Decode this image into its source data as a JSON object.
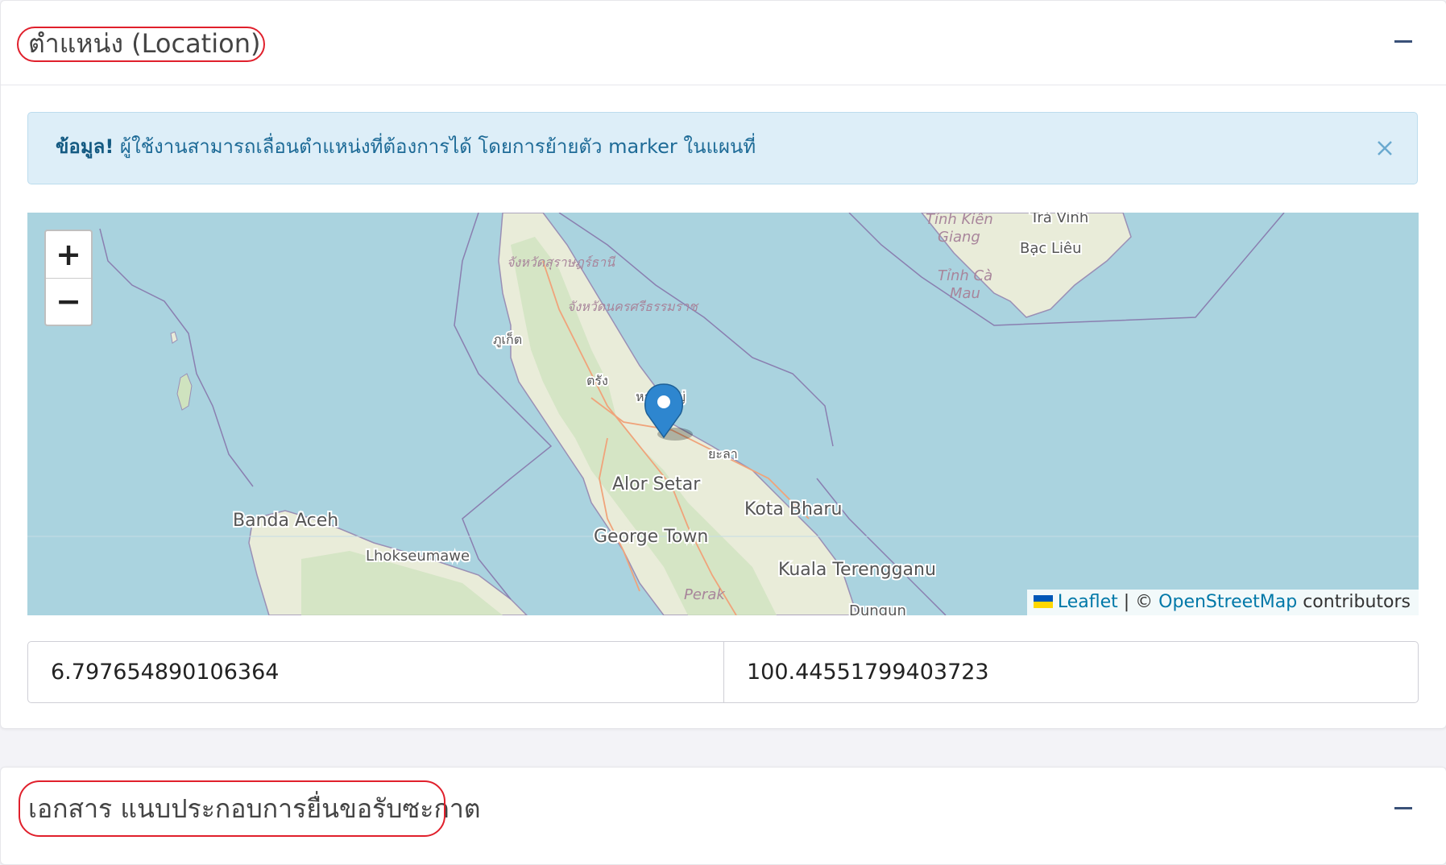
{
  "location_card": {
    "title": "ตำแหน่ง (Location)",
    "collapse_icon": "minus-icon"
  },
  "alert": {
    "strong": "ข้อมูล!",
    "message": " ผู้ใช้งานสามารถเลื่อนตำแหน่งที่ต้องการได้ โดยการย้ายตัว marker ในแผนที่",
    "close_icon": "close-icon",
    "color": "#1e6b97",
    "background": "#ddeef8"
  },
  "map": {
    "zoom_in": "+",
    "zoom_out": "−",
    "labels": {
      "tinh_kien_giang_1": "Tỉnh Kiên",
      "tinh_kien_giang_2": "Giang",
      "tra_vinh": "Trà Vinh",
      "bac_lieu": "Bạc Liêu",
      "tinh_ca_mau_1": "Tỉnh Cà",
      "tinh_ca_mau_2": "Mau",
      "surat_thani": "จังหวัดสุราษฎร์ธานี",
      "nakhon_si_thammarat": "จังหวัดนครศรีธรรมราช",
      "phuket": "ภูเก็ต",
      "trang": "ตรัง",
      "hat_yai": "หาดใหญ่",
      "yala": "ยะลา",
      "alor_setar": "Alor Setar",
      "kota_bharu": "Kota Bharu",
      "banda_aceh": "Banda Aceh",
      "george_town": "George Town",
      "lhokseumawe": "Lhokseumawe",
      "kuala_terengganu": "Kuala Terengganu",
      "perak": "Perak",
      "dungun": "Dungun"
    },
    "attribution": {
      "leaflet": "Leaflet",
      "separator": " | © ",
      "osm": "OpenStreetMap",
      "contributors": " contributors"
    },
    "marker_icon": "map-marker-icon",
    "marker_color": "#2e86cf",
    "water_color": "#aad3df",
    "land_color": "#f2efe9"
  },
  "coordinates": {
    "latitude": "6.797654890106364",
    "longitude": "100.44551799403723"
  },
  "documents_card": {
    "title": "เอกสาร แนบประกอบการยื่นขอรับซะกาต",
    "collapse_icon": "minus-icon"
  }
}
